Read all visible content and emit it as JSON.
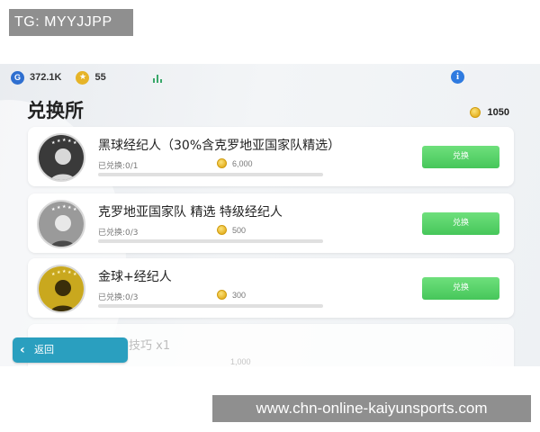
{
  "overlay": {
    "tg_label": "TG: MYYJJPP",
    "url_banner": "www.chn-online-kaiyunsports.com"
  },
  "topbar": {
    "g_icon_glyph": "G",
    "g_value": "372.1K",
    "star_icon_glyph": "★",
    "star_value": "55",
    "info_icon_glyph": "i"
  },
  "page": {
    "title": "兑换所",
    "token_total": "1050"
  },
  "offers": [
    {
      "title": "黑球经纪人（30%含克罗地亚国家队精选）",
      "redeemed": "已兑换:0/1",
      "cost": "6,000",
      "progress": 0,
      "button": "兑换",
      "tier_color": "#3a3a3a"
    },
    {
      "title": "克罗地亚国家队 精选 特级经纪人",
      "redeemed": "已兑换:0/3",
      "cost": "500",
      "progress": 0,
      "button": "兑换",
      "tier_color": "#9a9a9a"
    },
    {
      "title": "金球+经纪人",
      "redeemed": "已兑换:0/3",
      "cost": "300",
      "progress": 0,
      "button": "兑换",
      "tier_color": "#c9a81e"
    }
  ],
  "partial_offer": {
    "title": "…技巧 x1",
    "cost": "1,000"
  },
  "footer": {
    "back_glyph": "‹",
    "back_label": "返回"
  },
  "colors": {
    "accent_green": "#4fcc63",
    "back_teal": "#2a9fbf",
    "info_blue": "#2f7be0",
    "coin_gold": "#e6b428"
  }
}
